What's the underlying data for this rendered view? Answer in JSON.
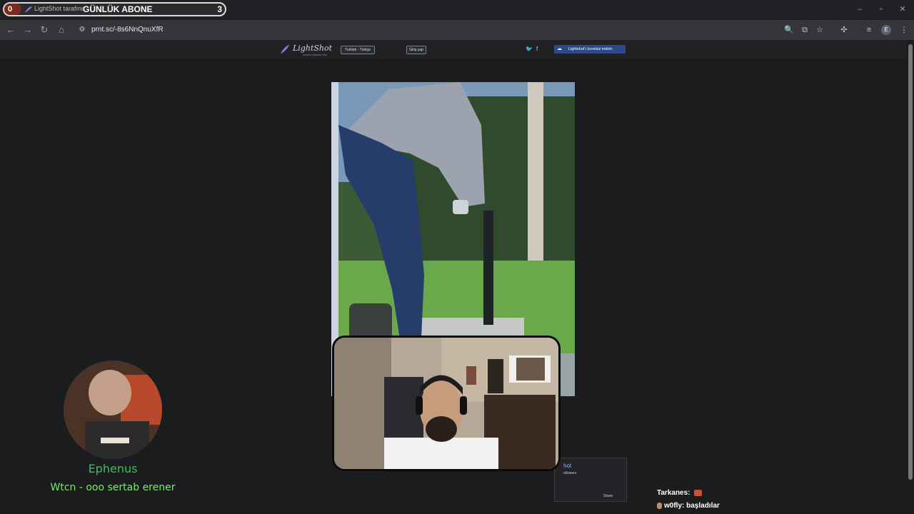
{
  "overlay": {
    "abone_left_count": "0",
    "abone_title": "GÜNLÜK ABONE",
    "abone_right_count": "3"
  },
  "browser": {
    "tab_title": "LightShot tarafında",
    "url": "prnt.sc/-8s6NnQnuXfR",
    "profile_initial": "E"
  },
  "lightshot": {
    "logo_text": "LightShot",
    "logo_tagline": "screen capture tool",
    "language": "Turkish - Türkçe",
    "login": "Giriş yap",
    "download": "Lightshot'ı ücretsiz indirin",
    "share_hot": "hot",
    "share_followers": "ollowers",
    "share_button": "Share"
  },
  "chat": {
    "left_user": "Ephenus",
    "left_message": "Wtcn - ooo sertab erener",
    "right_lines": [
      {
        "user": "Tarkanes:",
        "text": ""
      },
      {
        "user": "w0fly:",
        "text": "başladılar"
      }
    ]
  },
  "colors": {
    "page_bg": "#1b1c1d",
    "download_btn": "#2d4a86",
    "chat_user": "#37c25a",
    "chat_msg": "#7bea6b"
  }
}
